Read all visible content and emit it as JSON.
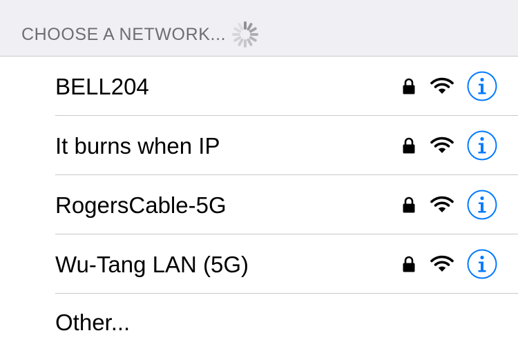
{
  "header": {
    "label": "CHOOSE A NETWORK..."
  },
  "networks": [
    {
      "name": "BELL204",
      "secured": true,
      "signal": "full"
    },
    {
      "name": "It burns when IP",
      "secured": true,
      "signal": "full"
    },
    {
      "name": "RogersCable-5G",
      "secured": true,
      "signal": "full"
    },
    {
      "name": "Wu-Tang LAN (5G)",
      "secured": true,
      "signal": "full"
    }
  ],
  "other": {
    "label": "Other..."
  },
  "icons": {
    "spinner": "loading-spinner-icon",
    "lock": "lock-icon",
    "wifi": "wifi-icon",
    "info": "info-icon"
  },
  "colors": {
    "accent": "#007aff",
    "header_bg": "#efeff4",
    "header_text": "#6d6d72",
    "separator": "#c8c7cc"
  }
}
